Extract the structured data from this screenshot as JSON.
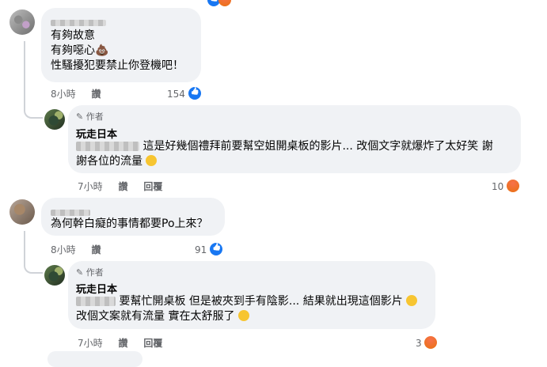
{
  "comments": [
    {
      "lines": [
        "有夠故意",
        "有夠噁心💩",
        "性騷擾犯要禁止你登機吧！"
      ],
      "time": "8小時",
      "like": "讚",
      "count": "154"
    },
    {
      "badge": "作者",
      "name": "玩走日本",
      "text1": "這是好幾個禮拜前要幫空姐開桌板的影片... 改個文字就爆炸了太好笑 謝",
      "text2": "謝各位的流量",
      "time": "7小時",
      "like": "讚",
      "reply": "回覆",
      "count": "10"
    },
    {
      "text": "為何幹白癡的事情都要Po上來？",
      "time": "8小時",
      "like": "讚",
      "count": "91"
    },
    {
      "badge": "作者",
      "name": "玩走日本",
      "text1": "要幫忙開桌板 但是被夾到手有陰影... 結果就出現這個影片",
      "text2": "改個文案就有流量 實在太舒服了",
      "time": "7小時",
      "like": "讚",
      "reply": "回覆",
      "count": "3"
    }
  ],
  "icons": {
    "pencil": "pencil-icon",
    "like": "like-reaction-icon",
    "angry": "angry-reaction-icon",
    "smile": "smile-emoji-icon",
    "sweat": "sweat-emoji-icon",
    "poop": "poop-emoji-icon"
  },
  "colors": {
    "bubble": "#f0f2f5",
    "meta": "#65676b",
    "like": "#1877f2",
    "angry": "#e9710f"
  }
}
